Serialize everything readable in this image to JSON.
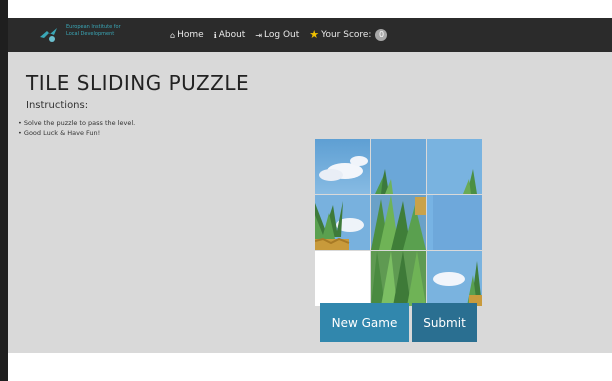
{
  "brand": {
    "logo_icon": "bird-logo-icon",
    "text": "European Institute for\nLocal Development"
  },
  "nav": {
    "home": "Home",
    "about": "About",
    "logout": "Log Out",
    "score_label": "Your Score:",
    "score_value": "0",
    "icons": {
      "home": "home-icon",
      "about": "info-icon",
      "logout": "logout-icon",
      "score": "star-icon"
    }
  },
  "page": {
    "title": "TILE SLIDING PUZZLE",
    "instructions_heading": "Instructions:",
    "instructions": [
      "Solve the puzzle to pass the level.",
      "Good Luck & Have Fun!"
    ]
  },
  "puzzle": {
    "rows": 3,
    "cols": 3,
    "image": "pineapples-under-blue-sky",
    "tiles": [
      {
        "row": 0,
        "col": 0,
        "content": "sky-clouds"
      },
      {
        "row": 0,
        "col": 1,
        "content": "sky-palm"
      },
      {
        "row": 0,
        "col": 2,
        "content": "sky-palm-right"
      },
      {
        "row": 1,
        "col": 0,
        "content": "pineapple-left"
      },
      {
        "row": 1,
        "col": 1,
        "content": "pineapple-leaves"
      },
      {
        "row": 1,
        "col": 2,
        "content": "sky-plain"
      },
      {
        "row": 2,
        "col": 0,
        "content": "blank"
      },
      {
        "row": 2,
        "col": 1,
        "content": "pineapple-leaves-dense"
      },
      {
        "row": 2,
        "col": 2,
        "content": "sky-pineapple-top"
      }
    ]
  },
  "buttons": {
    "new_game": "New Game",
    "submit": "Submit"
  },
  "colors": {
    "navbar": "#2b2b2b",
    "content_bg": "#d9d9d9",
    "button_primary": "#3187ad",
    "button_submit": "#2a6f91",
    "star": "#f2c200"
  }
}
